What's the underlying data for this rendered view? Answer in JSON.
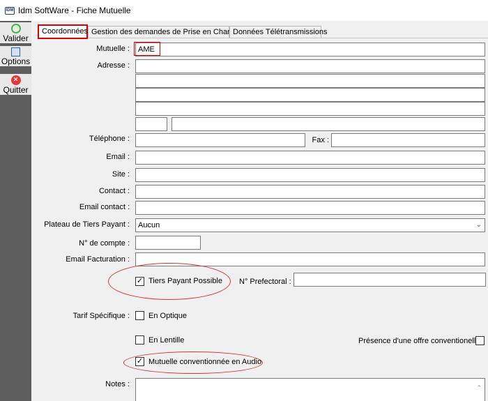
{
  "window": {
    "title": "Idm SoftWare - Fiche Mutuelle",
    "icon_text": "IDM"
  },
  "sidebar": {
    "valider": "Valider",
    "options": "Options",
    "quitter": "Quitter"
  },
  "tabs": [
    "Coordonnées",
    "Gestion des demandes de Prise en Charge",
    "Données Télétransmissions"
  ],
  "form": {
    "mutuelle_label": "Mutuelle :",
    "mutuelle_value": "AME",
    "adresse_label": "Adresse :",
    "adresse_lines": [
      "",
      "",
      "",
      ""
    ],
    "code_postal": "",
    "ville": "",
    "telephone_label": "Téléphone :",
    "telephone_value": "",
    "fax_label": "Fax :",
    "fax_value": "",
    "email_label": "Email :",
    "email_value": "",
    "site_label": "Site :",
    "site_value": "",
    "contact_label": "Contact :",
    "contact_value": "",
    "email_contact_label": "Email contact :",
    "email_contact_value": "",
    "plateau_label": "Plateau de Tiers Payant :",
    "plateau_value": "Aucun",
    "compte_label": "N° de compte :",
    "compte_value": "",
    "email_facturation_label": "Email Facturation :",
    "email_facturation_value": "",
    "tiers_payant_label": "Tiers Payant Possible",
    "tiers_payant_checked": true,
    "prefectoral_label": "N° Prefectoral :",
    "prefectoral_value": "",
    "tarif_label": "Tarif Spécifique :",
    "en_optique_label": "En Optique",
    "en_optique_checked": false,
    "en_lentille_label": "En Lentille",
    "en_lentille_checked": false,
    "offre_label": "Présence d'une offre conventionelle",
    "offre_checked": false,
    "audio_label": "Mutuelle conventionnée en Audio",
    "audio_checked": true,
    "notes_label": "Notes :",
    "notes_value": ""
  },
  "colors": {
    "highlight": "#e00000",
    "sidebar": "#5e5e5e"
  }
}
